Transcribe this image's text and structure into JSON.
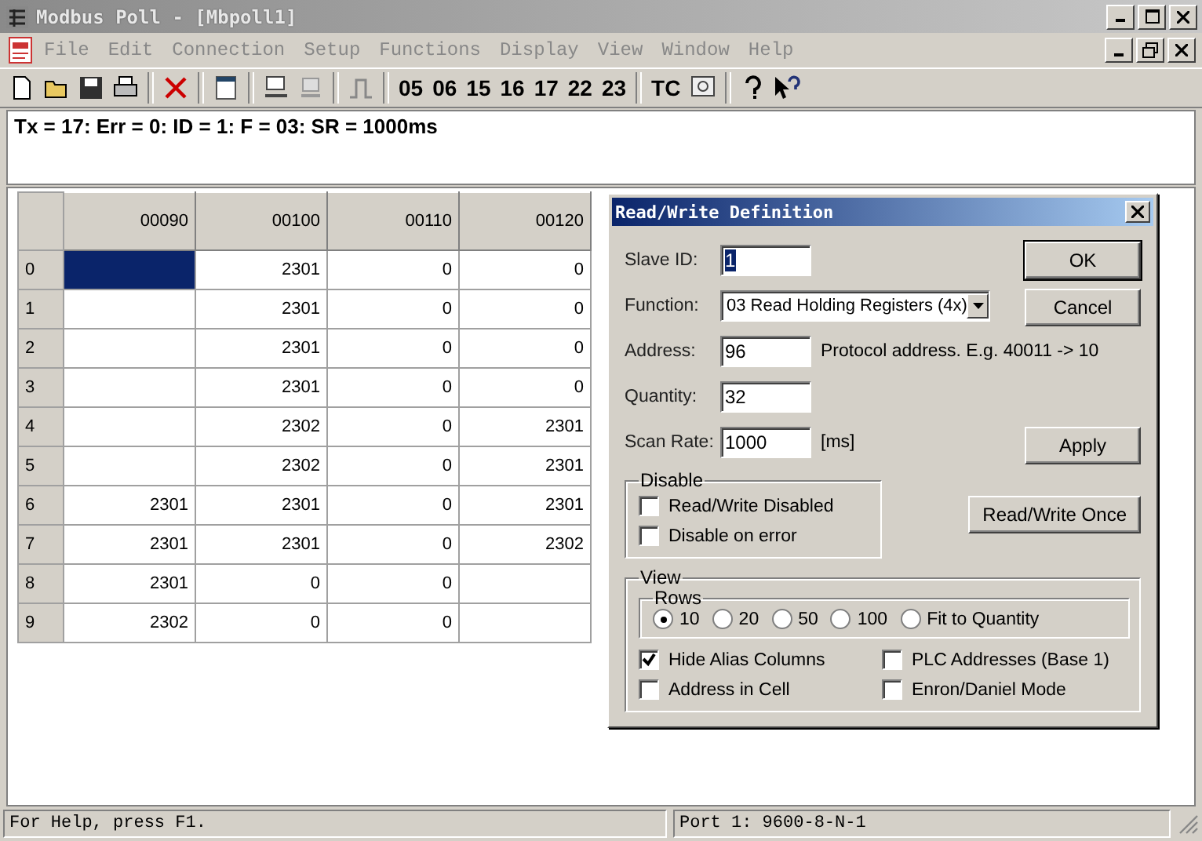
{
  "window": {
    "title": "Modbus Poll - [Mbpoll1]"
  },
  "menu": [
    "File",
    "Edit",
    "Connection",
    "Setup",
    "Functions",
    "Display",
    "View",
    "Window",
    "Help"
  ],
  "toolbar": {
    "function_codes": [
      "05",
      "06",
      "15",
      "16",
      "17",
      "22",
      "23"
    ],
    "tc": "TC"
  },
  "message": "Tx = 17: Err = 0: ID = 1: F = 03: SR = 1000ms",
  "table": {
    "columns": [
      "00090",
      "00100",
      "00110",
      "00120"
    ],
    "rows": [
      {
        "label": "0",
        "cells": [
          {
            "selected": true
          },
          {
            "v": "2301",
            "selected": false
          },
          {
            "v": "0",
            "selected": false
          },
          {
            "v": "0",
            "selected": false
          }
        ]
      },
      {
        "label": "1",
        "cells": [
          {
            "selected": false
          },
          {
            "v": "2301",
            "selected": false
          },
          {
            "v": "0",
            "selected": false
          },
          {
            "v": "0",
            "selected": false
          }
        ]
      },
      {
        "label": "2",
        "cells": [
          {
            "selected": false
          },
          {
            "v": "2301",
            "selected": false
          },
          {
            "v": "0",
            "selected": false
          },
          {
            "v": "0",
            "selected": false
          }
        ]
      },
      {
        "label": "3",
        "cells": [
          {
            "selected": false
          },
          {
            "v": "2301",
            "selected": false
          },
          {
            "v": "0",
            "selected": false
          },
          {
            "v": "0",
            "selected": false
          }
        ]
      },
      {
        "label": "4",
        "cells": [
          {
            "selected": false
          },
          {
            "v": "2302",
            "selected": false
          },
          {
            "v": "0",
            "selected": false
          },
          {
            "v": "2301",
            "selected": false
          }
        ]
      },
      {
        "label": "5",
        "cells": [
          {
            "selected": false
          },
          {
            "v": "2302",
            "selected": false
          },
          {
            "v": "0",
            "selected": false
          },
          {
            "v": "2301",
            "selected": false
          }
        ]
      },
      {
        "label": "6",
        "cells": [
          {
            "v": "2301",
            "selected": false
          },
          {
            "v": "2301",
            "selected": false
          },
          {
            "v": "0",
            "selected": false
          },
          {
            "v": "2301",
            "selected": false
          }
        ]
      },
      {
        "label": "7",
        "cells": [
          {
            "v": "2301",
            "selected": false
          },
          {
            "v": "2301",
            "selected": false
          },
          {
            "v": "0",
            "selected": false
          },
          {
            "v": "2302",
            "selected": false
          }
        ]
      },
      {
        "label": "8",
        "cells": [
          {
            "v": "2301",
            "selected": false
          },
          {
            "v": "0",
            "selected": false
          },
          {
            "v": "0",
            "selected": false
          },
          {
            "selected": false
          }
        ]
      },
      {
        "label": "9",
        "cells": [
          {
            "v": "2302",
            "selected": false
          },
          {
            "v": "0",
            "selected": false
          },
          {
            "v": "0",
            "selected": false
          },
          {
            "selected": false
          }
        ]
      }
    ]
  },
  "dialog": {
    "title": "Read/Write Definition",
    "fields": [
      {
        "kind": "text",
        "label": "Slave ID:",
        "value": "1"
      },
      {
        "kind": "combo",
        "label": "Function:",
        "value": "03 Read Holding Registers (4x)"
      },
      {
        "kind": "text",
        "label": "Address:",
        "value": "96",
        "note": "Protocol address. E.g. 40011 -> 10"
      },
      {
        "kind": "text",
        "label": "Quantity:",
        "value": "32"
      },
      {
        "kind": "text",
        "label": "Scan Rate:",
        "value": "1000",
        "note": "[ms]"
      }
    ],
    "buttons": {
      "ok": "OK",
      "cancel": "Cancel",
      "apply": "Apply",
      "once": "Read/Write Once"
    },
    "disable": {
      "title": "Disable",
      "options": [
        {
          "label": "Read/Write Disabled",
          "checked": false
        },
        {
          "label": "Disable on error",
          "checked": false
        }
      ]
    },
    "view": {
      "title": "View",
      "rows_title": "Rows",
      "rows_options": [
        {
          "label": "10",
          "selected": true
        },
        {
          "label": "20",
          "selected": false
        },
        {
          "label": "50",
          "selected": false
        },
        {
          "label": "100",
          "selected": false
        },
        {
          "label": "Fit to Quantity",
          "selected": false
        }
      ],
      "options": [
        {
          "label": "Hide Alias Columns",
          "checked": true
        },
        {
          "label": "PLC Addresses (Base 1)",
          "checked": false
        },
        {
          "label": "Address in Cell",
          "checked": false
        },
        {
          "label": "Enron/Daniel Mode",
          "checked": false
        }
      ]
    }
  },
  "status_bar": [
    "For Help, press F1.",
    "Port 1: 9600-8-N-1"
  ]
}
